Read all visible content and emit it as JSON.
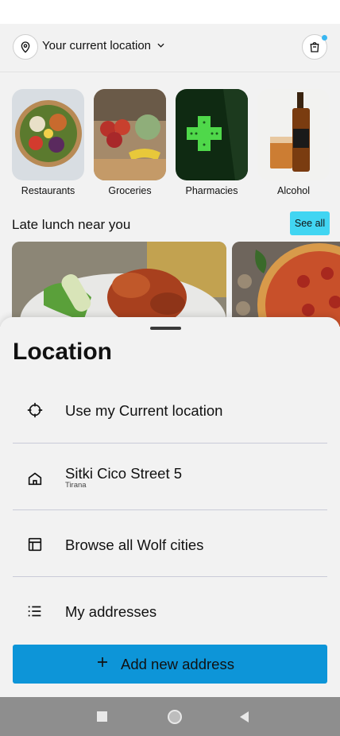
{
  "header": {
    "location_label": "Your current location"
  },
  "categories": [
    {
      "label": "Restaurants"
    },
    {
      "label": "Groceries"
    },
    {
      "label": "Pharmacies"
    },
    {
      "label": "Alcohol"
    }
  ],
  "section": {
    "title": "Late lunch near you",
    "see_all_label": "See all"
  },
  "sheet": {
    "title": "Location",
    "items": [
      {
        "label": "Use my Current location",
        "icon": "crosshair-icon"
      },
      {
        "label": "Sitki Cico Street 5",
        "sublabel": "Tirana",
        "icon": "home-icon"
      },
      {
        "label": "Browse all Wolf cities",
        "icon": "layout-icon"
      },
      {
        "label": "My addresses",
        "icon": "list-icon"
      }
    ],
    "add_button_label": "Add new address"
  },
  "colors": {
    "accent": "#0d95d8",
    "see_all_bg": "#41d5f2",
    "background": "#f2f2f2",
    "nav_bar": "#8e8e8e"
  }
}
